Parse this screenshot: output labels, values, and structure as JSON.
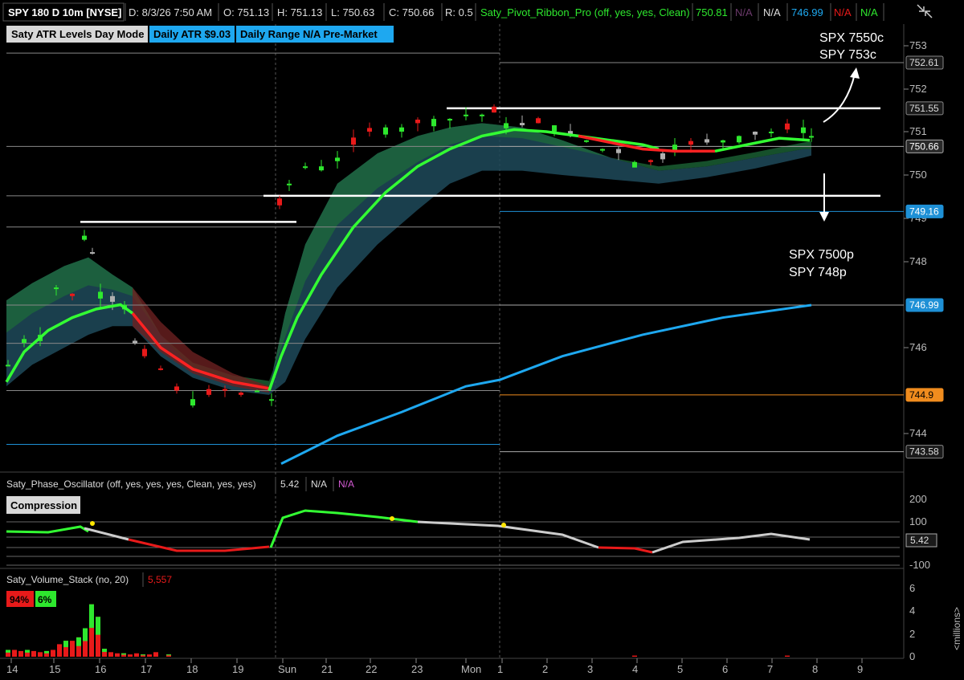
{
  "header": {
    "symbol": "SPY 180 D 10m [NYSE]",
    "date": "D: 8/3/26 7:50 AM",
    "open": "O: 751.13",
    "high": "H: 751.13",
    "low": "L: 750.63",
    "close": "C: 750.66",
    "range": "R: 0.5",
    "study": "Saty_Pivot_Ribbon_Pro (off, yes, yes, Clean)",
    "study_val1": "750.81",
    "study_val2": "N/A",
    "study_val3": "N/A",
    "study_val4": "746.99",
    "study_val5": "N/A",
    "study_val6": "N/A"
  },
  "badges": {
    "mode": "Saty ATR Levels Day Mode",
    "atr": "Daily ATR $9.03",
    "range": "Daily Range N/A Pre-Market"
  },
  "annotations": {
    "top_right_1": "SPX 7550c",
    "top_right_2": "SPY 753c",
    "mid_right_1": "SPX 7500p",
    "mid_right_2": "SPY 748p"
  },
  "price_tags": [
    {
      "label": "752.61",
      "price": 752.61,
      "bg": "#1a1a1a",
      "fg": "#ddd",
      "border": "#888"
    },
    {
      "label": "751.55",
      "price": 751.55,
      "bg": "#1a1a1a",
      "fg": "#ddd",
      "border": "#888"
    },
    {
      "label": "750.66",
      "price": 750.66,
      "bg": "#2a2a2a",
      "fg": "#fff",
      "border": "#aaa"
    },
    {
      "label": "749.16",
      "price": 749.16,
      "bg": "#1e90d6",
      "fg": "#fff",
      "border": "#1e90d6"
    },
    {
      "label": "746.99",
      "price": 746.99,
      "bg": "#1e90d6",
      "fg": "#fff",
      "border": "#1e90d6"
    },
    {
      "label": "744.9",
      "price": 744.9,
      "bg": "#f08c1e",
      "fg": "#000",
      "border": "#f08c1e"
    },
    {
      "label": "743.58",
      "price": 743.58,
      "bg": "#1a1a1a",
      "fg": "#ddd",
      "border": "#888"
    }
  ],
  "oscillator": {
    "title": "Saty_Phase_Oscillator (off, yes, yes, yes, Clean, yes, yes)",
    "value": "5.42",
    "v2": "N/A",
    "v3": "N/A",
    "badge": "Compression",
    "axis_ticks": [
      "200",
      "100",
      "-100"
    ],
    "current": "5.42"
  },
  "volume": {
    "title": "Saty_Volume_Stack (no, 20)",
    "value": "5,557",
    "red_pct": "94%",
    "green_pct": "6%",
    "axis_ticks": [
      "6",
      "4",
      "2",
      "0"
    ],
    "unit": "<millions>"
  },
  "chart_data": {
    "type": "candlestick",
    "ylim": [
      743.2,
      753.3
    ],
    "y_ticks": [
      753,
      752,
      751,
      750,
      749,
      748,
      746,
      744
    ],
    "x_ticks": [
      "14",
      "15",
      "16",
      "17",
      "18",
      "19",
      "Sun",
      "21",
      "22",
      "23",
      "Mon",
      "1",
      "2",
      "3",
      "4",
      "5",
      "6",
      "7",
      "8",
      "9"
    ],
    "levels": [
      {
        "price": 752.61,
        "color": "#888888"
      },
      {
        "price": 751.55,
        "color": "#ffffff"
      },
      {
        "price": 750.66,
        "color": "#aaaaaa"
      },
      {
        "price": 749.52,
        "color": "#ffffff"
      },
      {
        "price": 749.16,
        "color": "#1e90d6"
      },
      {
        "price": 746.99,
        "color": "#aaaaaa"
      },
      {
        "price": 744.9,
        "color": "#f08c1e"
      },
      {
        "price": 743.58,
        "color": "#aaaaaa"
      }
    ],
    "colors": {
      "up": "#2ee82e",
      "down": "#e81a1a",
      "neutral": "#b0b0b0",
      "ema_fast": "#33ff33",
      "ema_slow_red": "#ff2222",
      "trend": "#1ea8f0"
    }
  }
}
